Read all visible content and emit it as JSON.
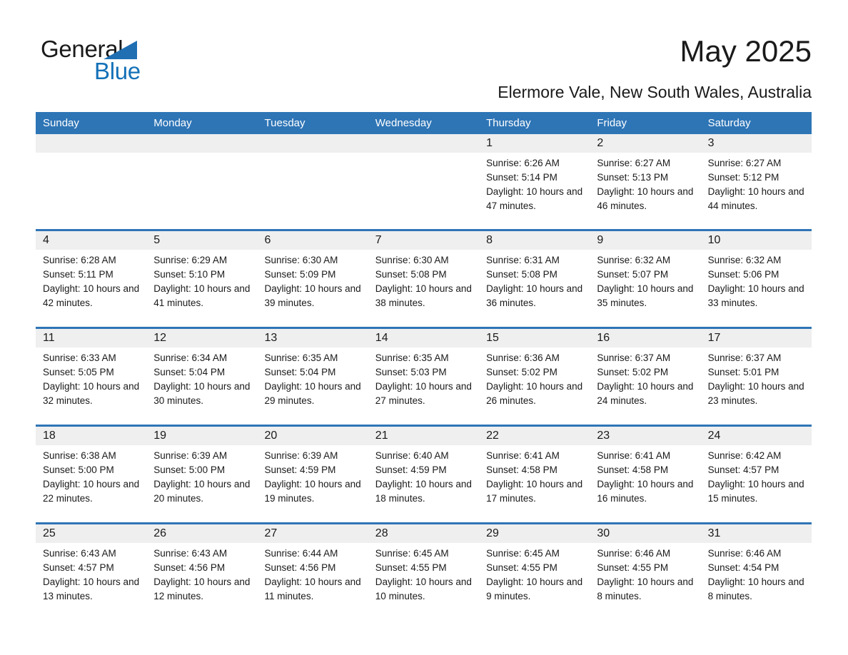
{
  "brand": {
    "name_part1": "General",
    "name_part2": "Blue",
    "triangle_color": "#1f6fb2",
    "blue_text_color": "#1471b8"
  },
  "header": {
    "title": "May 2025",
    "location": "Elermore Vale, New South Wales, Australia"
  },
  "theme": {
    "header_blue": "#2e75b6",
    "row_divider_blue": "#2e75b6",
    "daynum_band_gray": "#efefef",
    "text_color": "#1a1a1a"
  },
  "calendar": {
    "weekday_headers": [
      "Sunday",
      "Monday",
      "Tuesday",
      "Wednesday",
      "Thursday",
      "Friday",
      "Saturday"
    ],
    "weeks": [
      [
        {
          "day": "",
          "empty": true
        },
        {
          "day": "",
          "empty": true
        },
        {
          "day": "",
          "empty": true
        },
        {
          "day": "",
          "empty": true
        },
        {
          "day": "1",
          "sunrise": "Sunrise: 6:26 AM",
          "sunset": "Sunset: 5:14 PM",
          "daylight": "Daylight: 10 hours and 47 minutes."
        },
        {
          "day": "2",
          "sunrise": "Sunrise: 6:27 AM",
          "sunset": "Sunset: 5:13 PM",
          "daylight": "Daylight: 10 hours and 46 minutes."
        },
        {
          "day": "3",
          "sunrise": "Sunrise: 6:27 AM",
          "sunset": "Sunset: 5:12 PM",
          "daylight": "Daylight: 10 hours and 44 minutes."
        }
      ],
      [
        {
          "day": "4",
          "sunrise": "Sunrise: 6:28 AM",
          "sunset": "Sunset: 5:11 PM",
          "daylight": "Daylight: 10 hours and 42 minutes."
        },
        {
          "day": "5",
          "sunrise": "Sunrise: 6:29 AM",
          "sunset": "Sunset: 5:10 PM",
          "daylight": "Daylight: 10 hours and 41 minutes."
        },
        {
          "day": "6",
          "sunrise": "Sunrise: 6:30 AM",
          "sunset": "Sunset: 5:09 PM",
          "daylight": "Daylight: 10 hours and 39 minutes."
        },
        {
          "day": "7",
          "sunrise": "Sunrise: 6:30 AM",
          "sunset": "Sunset: 5:08 PM",
          "daylight": "Daylight: 10 hours and 38 minutes."
        },
        {
          "day": "8",
          "sunrise": "Sunrise: 6:31 AM",
          "sunset": "Sunset: 5:08 PM",
          "daylight": "Daylight: 10 hours and 36 minutes."
        },
        {
          "day": "9",
          "sunrise": "Sunrise: 6:32 AM",
          "sunset": "Sunset: 5:07 PM",
          "daylight": "Daylight: 10 hours and 35 minutes."
        },
        {
          "day": "10",
          "sunrise": "Sunrise: 6:32 AM",
          "sunset": "Sunset: 5:06 PM",
          "daylight": "Daylight: 10 hours and 33 minutes."
        }
      ],
      [
        {
          "day": "11",
          "sunrise": "Sunrise: 6:33 AM",
          "sunset": "Sunset: 5:05 PM",
          "daylight": "Daylight: 10 hours and 32 minutes."
        },
        {
          "day": "12",
          "sunrise": "Sunrise: 6:34 AM",
          "sunset": "Sunset: 5:04 PM",
          "daylight": "Daylight: 10 hours and 30 minutes."
        },
        {
          "day": "13",
          "sunrise": "Sunrise: 6:35 AM",
          "sunset": "Sunset: 5:04 PM",
          "daylight": "Daylight: 10 hours and 29 minutes."
        },
        {
          "day": "14",
          "sunrise": "Sunrise: 6:35 AM",
          "sunset": "Sunset: 5:03 PM",
          "daylight": "Daylight: 10 hours and 27 minutes."
        },
        {
          "day": "15",
          "sunrise": "Sunrise: 6:36 AM",
          "sunset": "Sunset: 5:02 PM",
          "daylight": "Daylight: 10 hours and 26 minutes."
        },
        {
          "day": "16",
          "sunrise": "Sunrise: 6:37 AM",
          "sunset": "Sunset: 5:02 PM",
          "daylight": "Daylight: 10 hours and 24 minutes."
        },
        {
          "day": "17",
          "sunrise": "Sunrise: 6:37 AM",
          "sunset": "Sunset: 5:01 PM",
          "daylight": "Daylight: 10 hours and 23 minutes."
        }
      ],
      [
        {
          "day": "18",
          "sunrise": "Sunrise: 6:38 AM",
          "sunset": "Sunset: 5:00 PM",
          "daylight": "Daylight: 10 hours and 22 minutes."
        },
        {
          "day": "19",
          "sunrise": "Sunrise: 6:39 AM",
          "sunset": "Sunset: 5:00 PM",
          "daylight": "Daylight: 10 hours and 20 minutes."
        },
        {
          "day": "20",
          "sunrise": "Sunrise: 6:39 AM",
          "sunset": "Sunset: 4:59 PM",
          "daylight": "Daylight: 10 hours and 19 minutes."
        },
        {
          "day": "21",
          "sunrise": "Sunrise: 6:40 AM",
          "sunset": "Sunset: 4:59 PM",
          "daylight": "Daylight: 10 hours and 18 minutes."
        },
        {
          "day": "22",
          "sunrise": "Sunrise: 6:41 AM",
          "sunset": "Sunset: 4:58 PM",
          "daylight": "Daylight: 10 hours and 17 minutes."
        },
        {
          "day": "23",
          "sunrise": "Sunrise: 6:41 AM",
          "sunset": "Sunset: 4:58 PM",
          "daylight": "Daylight: 10 hours and 16 minutes."
        },
        {
          "day": "24",
          "sunrise": "Sunrise: 6:42 AM",
          "sunset": "Sunset: 4:57 PM",
          "daylight": "Daylight: 10 hours and 15 minutes."
        }
      ],
      [
        {
          "day": "25",
          "sunrise": "Sunrise: 6:43 AM",
          "sunset": "Sunset: 4:57 PM",
          "daylight": "Daylight: 10 hours and 13 minutes."
        },
        {
          "day": "26",
          "sunrise": "Sunrise: 6:43 AM",
          "sunset": "Sunset: 4:56 PM",
          "daylight": "Daylight: 10 hours and 12 minutes."
        },
        {
          "day": "27",
          "sunrise": "Sunrise: 6:44 AM",
          "sunset": "Sunset: 4:56 PM",
          "daylight": "Daylight: 10 hours and 11 minutes."
        },
        {
          "day": "28",
          "sunrise": "Sunrise: 6:45 AM",
          "sunset": "Sunset: 4:55 PM",
          "daylight": "Daylight: 10 hours and 10 minutes."
        },
        {
          "day": "29",
          "sunrise": "Sunrise: 6:45 AM",
          "sunset": "Sunset: 4:55 PM",
          "daylight": "Daylight: 10 hours and 9 minutes."
        },
        {
          "day": "30",
          "sunrise": "Sunrise: 6:46 AM",
          "sunset": "Sunset: 4:55 PM",
          "daylight": "Daylight: 10 hours and 8 minutes."
        },
        {
          "day": "31",
          "sunrise": "Sunrise: 6:46 AM",
          "sunset": "Sunset: 4:54 PM",
          "daylight": "Daylight: 10 hours and 8 minutes."
        }
      ]
    ]
  }
}
